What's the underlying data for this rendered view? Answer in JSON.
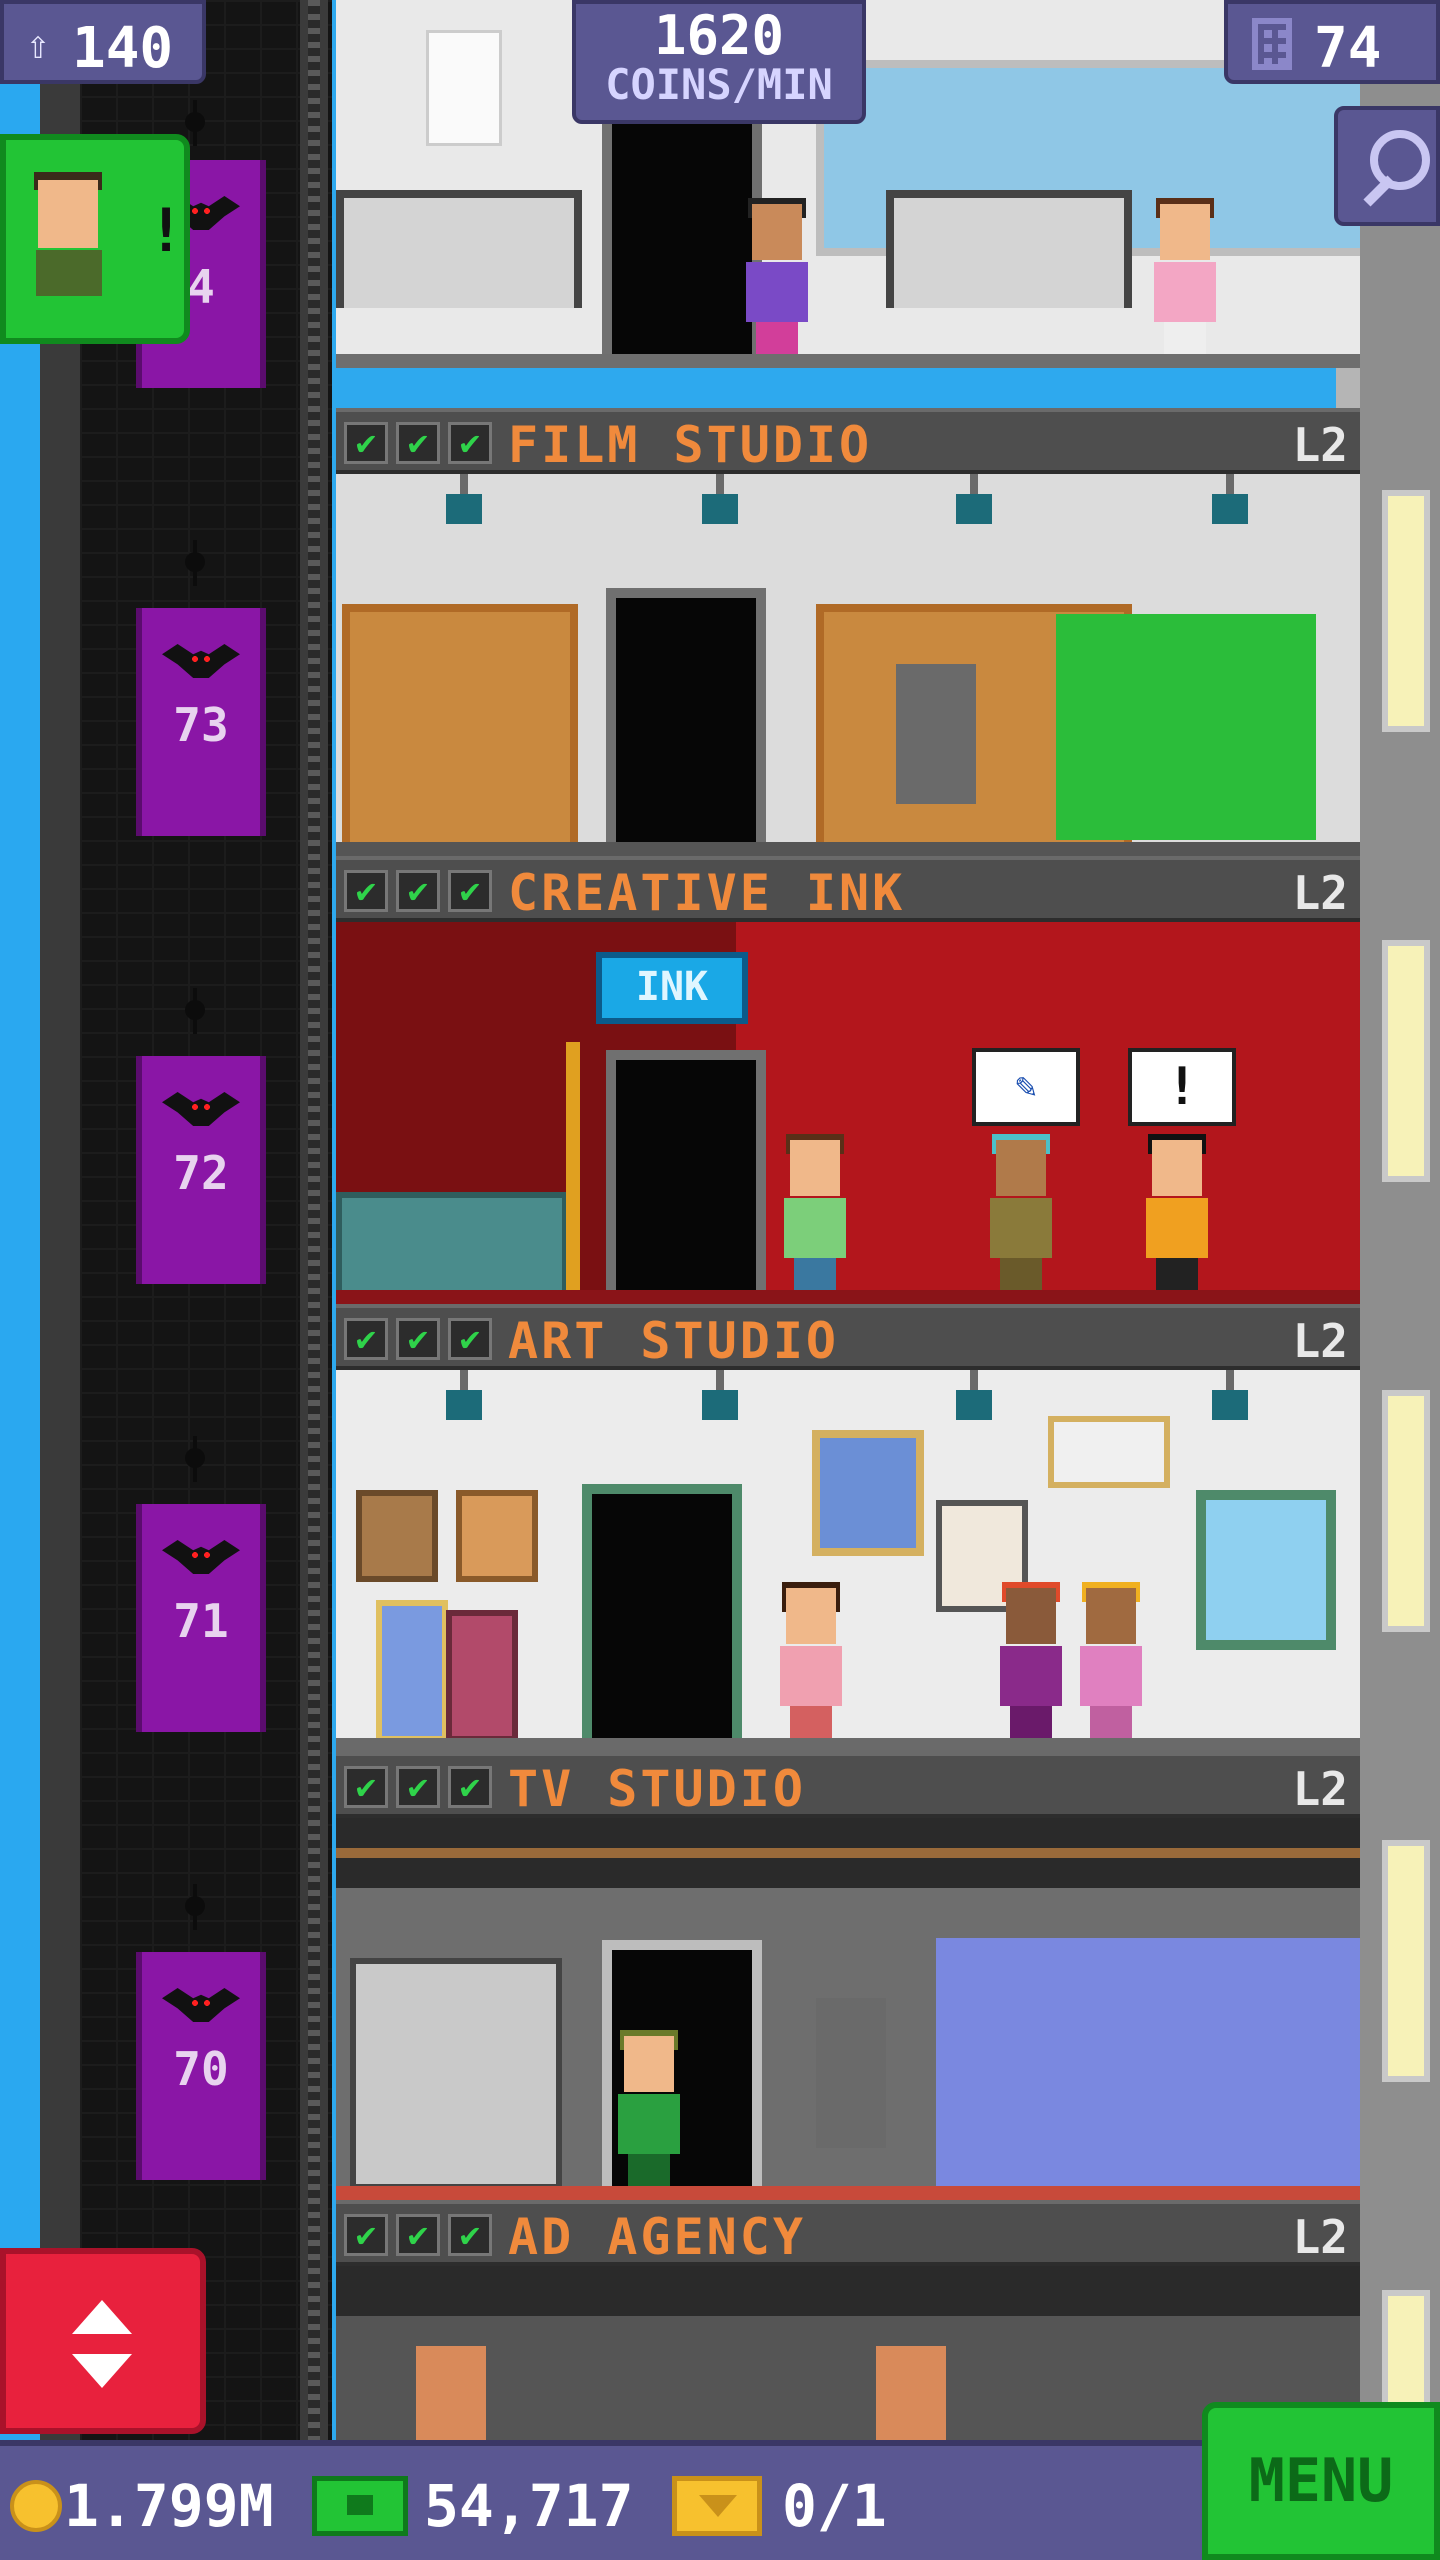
{
  "hud": {
    "population": "140",
    "coins_rate_value": "1620",
    "coins_rate_unit": "COINS/MIN",
    "floor_count": "74",
    "icons": {
      "population": "person-up-icon",
      "floors": "building-icon",
      "zoom": "magnifier-icon"
    }
  },
  "elevator": {
    "floor_labels": [
      "4",
      "73",
      "72",
      "71",
      "70"
    ]
  },
  "floors": [
    {
      "name": "FILM STUDIO",
      "level": "L2",
      "checks": [
        "✔",
        "✔",
        "✔"
      ]
    },
    {
      "name": "CREATIVE INK",
      "level": "L2",
      "checks": [
        "✔",
        "✔",
        "✔"
      ]
    },
    {
      "name": "ART STUDIO",
      "level": "L2",
      "checks": [
        "✔",
        "✔",
        "✔"
      ]
    },
    {
      "name": "TV STUDIO",
      "level": "L2",
      "checks": [
        "✔",
        "✔",
        "✔"
      ]
    },
    {
      "name": "AD AGENCY",
      "level": "L2",
      "checks": [
        "✔",
        "✔",
        "✔"
      ]
    }
  ],
  "room_signs": {
    "creative_ink_sign": "INK"
  },
  "visitor": {
    "alert": "!"
  },
  "speech_bubbles": [
    "!"
  ],
  "bottom_bar": {
    "coins": "1.799M",
    "bux": "54,717",
    "tickets": "0/1",
    "menu_label": "MENU"
  },
  "colors": {
    "accent_green": "#22c435",
    "accent_red": "#e8213d",
    "hud_purple": "#5a5792",
    "floor_name_orange": "#f08a3c",
    "elevator_purple": "#8a16a6"
  }
}
